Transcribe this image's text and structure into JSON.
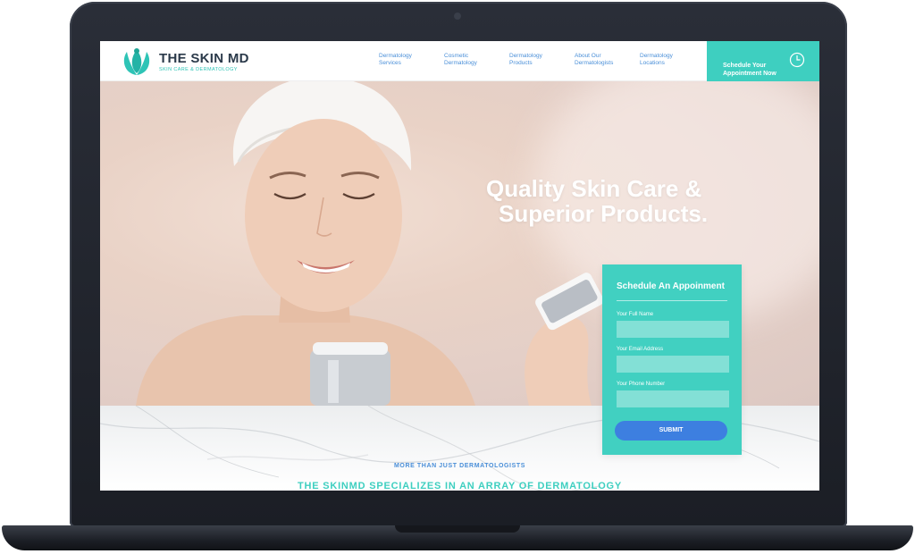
{
  "brand": {
    "name": "THE SKIN MD",
    "tagline": "SKIN CARE & DERMATOLOGY"
  },
  "nav": {
    "items": [
      {
        "label": "Dermatology\nServices"
      },
      {
        "label": "Cosmetic\nDermatology"
      },
      {
        "label": "Dermatology\nProducts"
      },
      {
        "label": "About Our\nDermatologists"
      },
      {
        "label": "Dermatology\nLocations"
      }
    ],
    "cta_label": "Schedule Your\nAppointment Now"
  },
  "hero": {
    "headline_line1": "Quality Skin Care &",
    "headline_line2": "Superior Products."
  },
  "form": {
    "title": "Schedule An Appoinment",
    "full_name_label": "Your Full Name",
    "email_label": "Your Email Address",
    "phone_label": "Your Phone Number",
    "submit_label": "SUBMIT"
  },
  "section": {
    "eyebrow": "MORE THAN JUST DERMATOLOGISTS",
    "heading": "THE SKINMD SPECIALIZES IN AN ARRAY OF DERMATOLOGY"
  },
  "colors": {
    "teal": "#41d0c1",
    "blue": "#3d7fe0",
    "navy": "#2b3a4a"
  }
}
